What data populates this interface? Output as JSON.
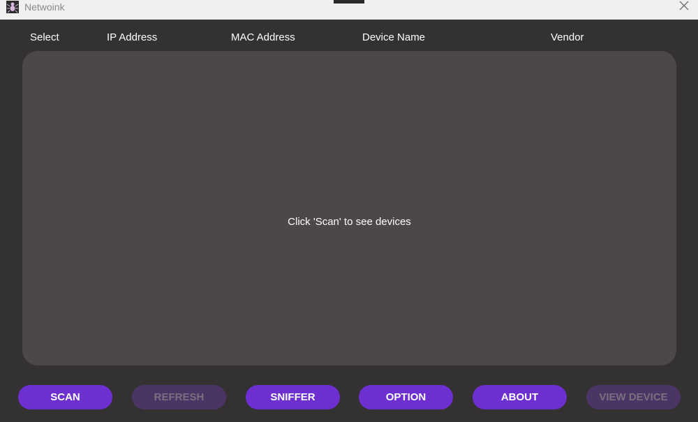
{
  "window": {
    "title": "Netwoink",
    "app_icon": "spider-logo-icon",
    "close_icon": "close-icon"
  },
  "table": {
    "columns": [
      "Select",
      "IP Address",
      "MAC Address",
      "Device Name",
      "Vendor"
    ],
    "empty_message": "Click 'Scan' to see devices"
  },
  "toolbar": {
    "buttons": [
      {
        "label": "SCAN",
        "enabled": true
      },
      {
        "label": "REFRESH",
        "enabled": false
      },
      {
        "label": "SNIFFER",
        "enabled": true
      },
      {
        "label": "OPTION",
        "enabled": true
      },
      {
        "label": "ABOUT",
        "enabled": true
      },
      {
        "label": "VIEW DEVICE",
        "enabled": false
      }
    ]
  },
  "colors": {
    "accent": "#6d2fcf",
    "accent_disabled": "#4a3564",
    "background": "#333132",
    "panel": "#4d4747"
  }
}
